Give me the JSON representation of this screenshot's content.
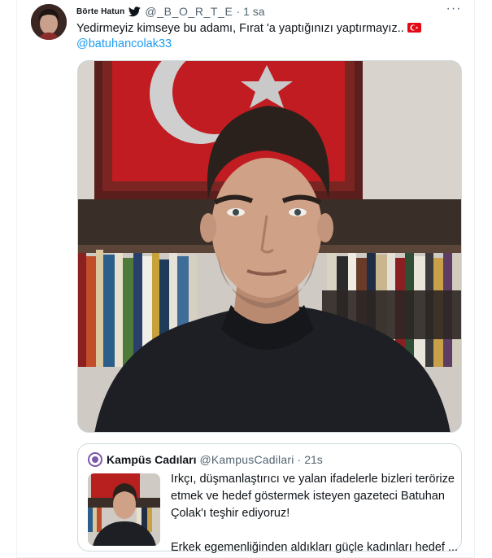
{
  "tweet": {
    "display_name": "Börte Hatun",
    "handle": "@_B_O_R_T_E",
    "separator": "·",
    "time": "1 sa",
    "more_label": "···",
    "text": "Yedirmeyiz kimseye bu adamı, Fırat 'a yaptığınızı yaptırmayız..",
    "mention": "@batuhancolak33",
    "flag_icon": "turkey-flag-icon",
    "link_color": "#1d9bf0"
  },
  "quote": {
    "name": "Kampüs Cadıları",
    "handle": "@KampusCadilari",
    "separator": "·",
    "time": "21s",
    "text_line1": "Irkçı, düşmanlaştırıcı ve yalan ifadelerle bizleri terörize etmek ve hedef göstermek isteyen gazeteci Batuhan Çolak'ı teşhir ediyoruz!",
    "text_line2": "Erkek egemenliğinden aldıkları güçle kadınları hedef ...",
    "avatar_icon": "kampus-cadilari-logo",
    "accent_color": "#7a5aa8"
  }
}
